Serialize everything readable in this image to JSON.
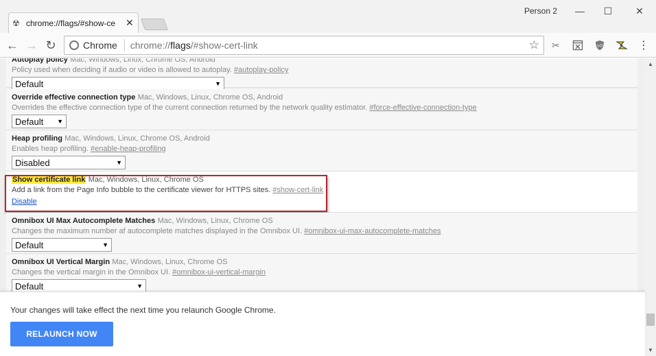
{
  "window": {
    "profile": "Person 2",
    "minimize": "—",
    "maximize": "☐",
    "close": "✕"
  },
  "tab": {
    "title": "chrome://flags/#show-ce",
    "close": "✕",
    "favicon": "radiation-icon"
  },
  "toolbar": {
    "back": "←",
    "forward": "→",
    "reload": "↻",
    "chip": "Chrome",
    "url_prefix": "chrome://",
    "url_host": "flags",
    "url_rest": "/#show-cert-link",
    "star": "☆"
  },
  "flags": [
    {
      "name": "Autoplay policy",
      "platforms": "Mac, Windows, Linux, Chrome OS, Android",
      "description": "Policy used when deciding if audio or video is allowed to autoplay.",
      "anchor": "#autoplay-policy",
      "select": "Default"
    },
    {
      "name": "Override effective connection type",
      "platforms": "Mac, Windows, Linux, Chrome OS, Android",
      "description": "Overrides the effective connection type of the current connection returned by the network quality estimator.",
      "anchor": "#force-effective-connection-type",
      "select": "Default"
    },
    {
      "name": "Heap profiling",
      "platforms": "Mac, Windows, Linux, Chrome OS, Android",
      "description": "Enables heap profiling.",
      "anchor": "#enable-heap-profiling",
      "select": "Disabled"
    },
    {
      "name": "Show certificate link",
      "platforms": "Mac, Windows, Linux, Chrome OS",
      "description": "Add a link from the Page Info bubble to the certificate viewer for HTTPS sites.",
      "anchor": "#show-cert-link",
      "action": "Disable"
    },
    {
      "name": "Omnibox UI Max Autocomplete Matches",
      "platforms": "Mac, Windows, Linux, Chrome OS",
      "description": "Changes the maximum number af autocomplete matches displayed in the Omnibox UI.",
      "anchor": "#omnibox-ui-max-autocomplete-matches",
      "select": "Default"
    },
    {
      "name": "Omnibox UI Vertical Margin",
      "platforms": "Mac, Windows, Linux, Chrome OS",
      "description": "Changes the vertical margin in the Omnibox UI.",
      "anchor": "#omnibox-ui-vertical-margin",
      "select": "Default"
    }
  ],
  "banner": {
    "message": "Your changes will take effect the next time you relaunch Google Chrome.",
    "button": "RELAUNCH NOW"
  },
  "colors": {
    "highlight": "#ffeb3b",
    "annotation_box": "#b3272e",
    "relaunch_button": "#4285f4",
    "link": "#1155cc"
  }
}
